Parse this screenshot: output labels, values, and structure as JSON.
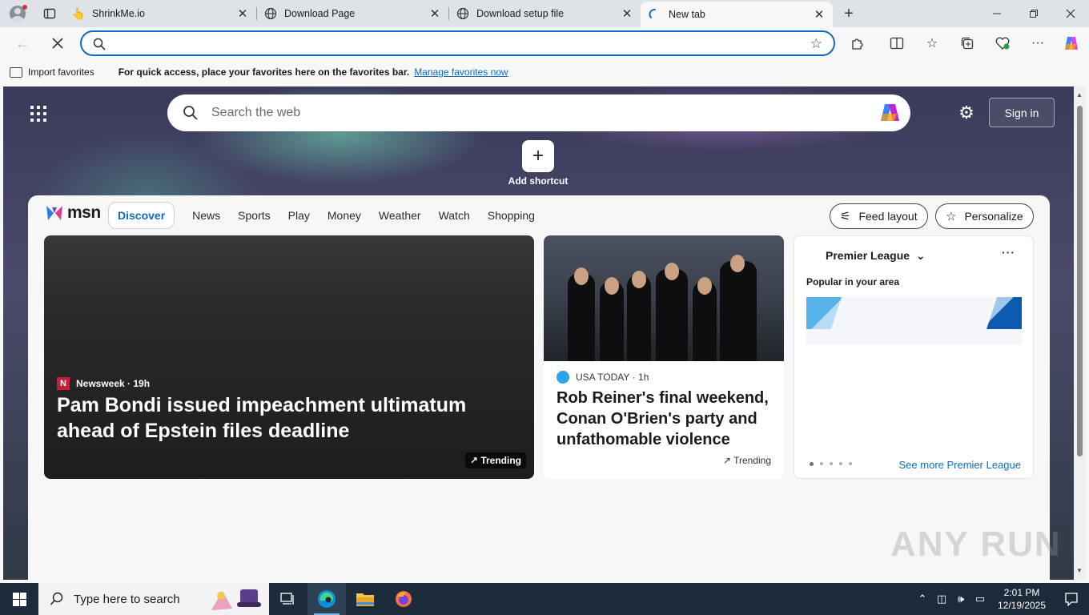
{
  "browser": {
    "tabs": [
      {
        "title": "ShrinkMe.io",
        "favicon": "hand-pointer-icon",
        "active": false
      },
      {
        "title": "Download Page",
        "favicon": "globe-icon",
        "active": false
      },
      {
        "title": "Download setup file",
        "favicon": "globe-icon",
        "active": false
      },
      {
        "title": "New tab",
        "favicon": "loading-spinner-icon",
        "active": true
      }
    ],
    "address_value": "",
    "favorites_bar": {
      "import_label": "Import favorites",
      "message": "For quick access, place your favorites here on the favorites bar.",
      "link": "Manage favorites now"
    }
  },
  "newtab": {
    "search_placeholder": "Search the web",
    "sign_in": "Sign in",
    "add_shortcut": "Add shortcut",
    "msn_word": "msn",
    "nav": [
      "Discover",
      "News",
      "Sports",
      "Play",
      "Money",
      "Weather",
      "Watch",
      "Shopping"
    ],
    "feed_layout": "Feed layout",
    "personalize": "Personalize",
    "cards": {
      "hero": {
        "source": "Newsweek",
        "age": "· 19h",
        "headline": "Pam Bondi issued impeachment ultimatum ahead of Epstein files deadline",
        "badge": "Trending"
      },
      "second": {
        "source": "USA TODAY",
        "age": "· 1h",
        "headline": "Rob Reiner's final weekend, Conan O'Brien's party and unfathomable violence",
        "badge": "Trending"
      },
      "sports": {
        "league": "Premier League",
        "subtitle": "Popular in your area",
        "see_more": "See more Premier League"
      }
    },
    "watermark": "ANY RUN"
  },
  "taskbar": {
    "search_placeholder": "Type here to search",
    "time": "2:01 PM",
    "date": "12/19/2025"
  },
  "colors": {
    "accent": "#0f6cbd",
    "taskbar": "#1c2b3a"
  }
}
